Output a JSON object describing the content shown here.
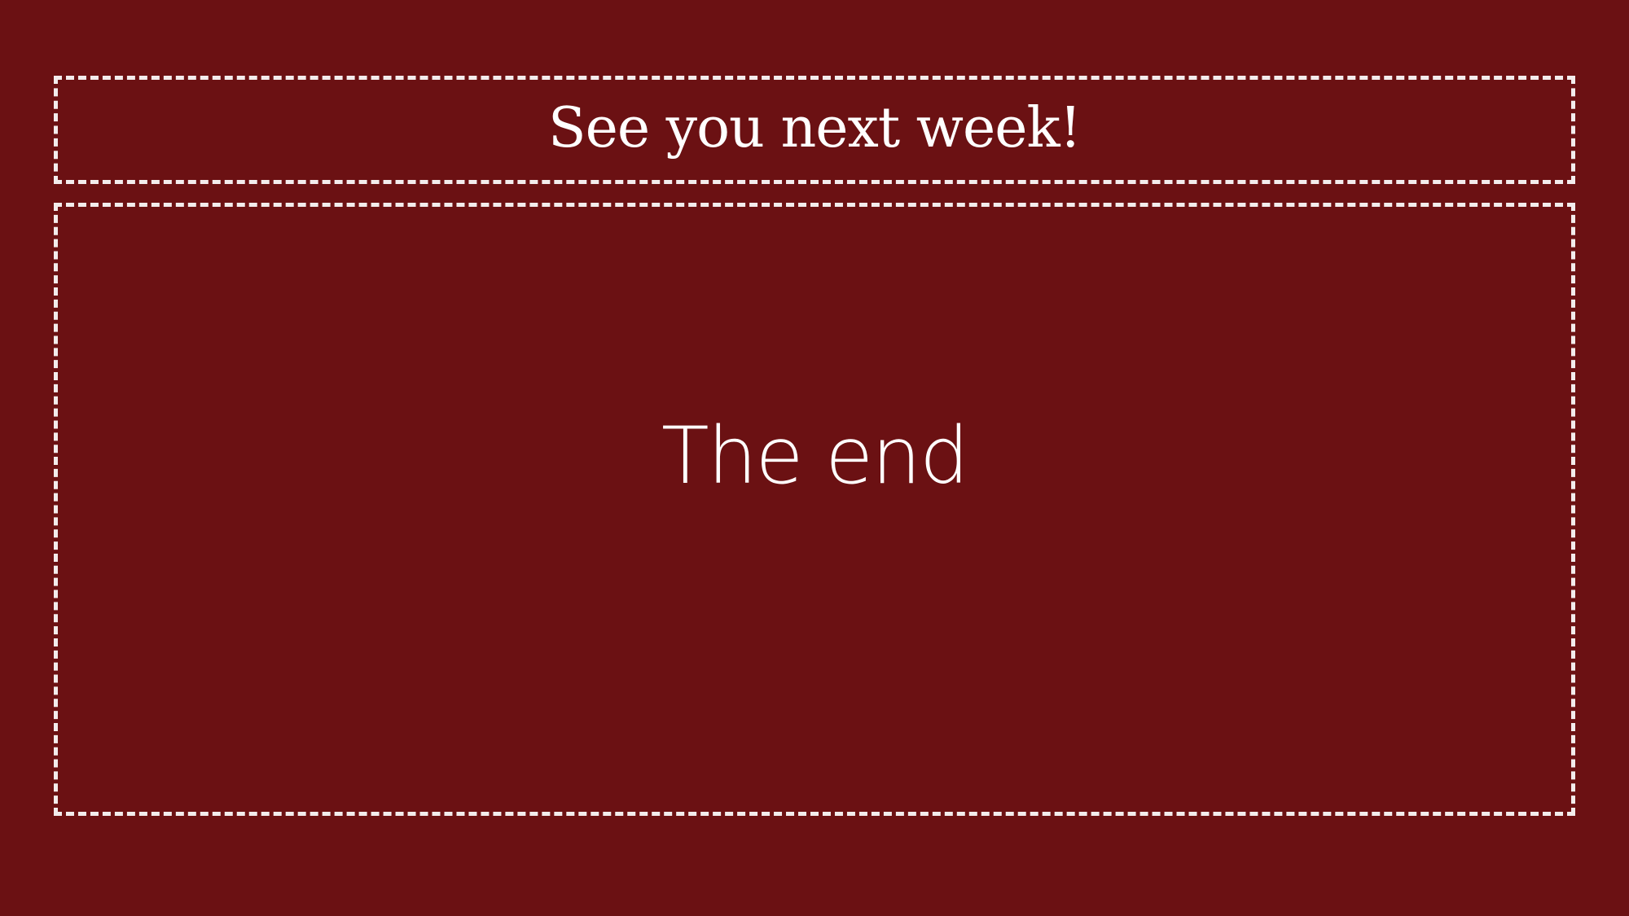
{
  "slide": {
    "title": "See you next week!",
    "body": "The end"
  },
  "colors": {
    "background": "#6b1113",
    "text": "#ffffff",
    "border": "#ffffff"
  }
}
